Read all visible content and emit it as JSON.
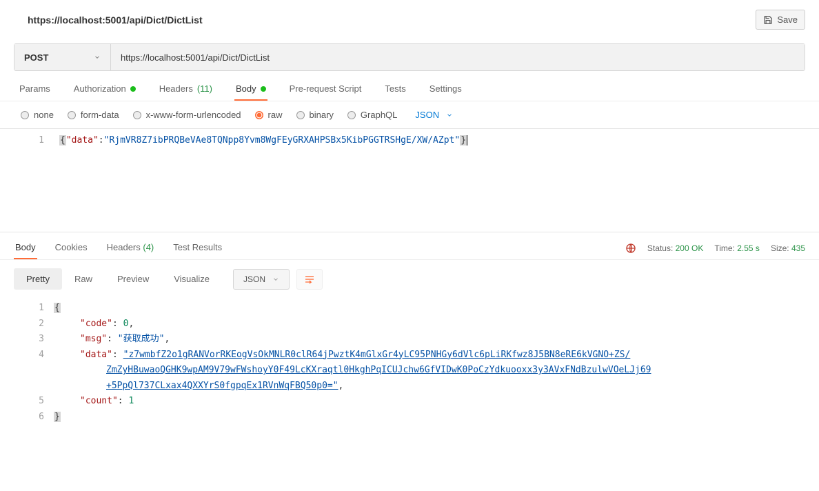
{
  "header": {
    "url_title": "https://localhost:5001/api/Dict/DictList",
    "save_label": "Save"
  },
  "request": {
    "method": "POST",
    "url": "https://localhost:5001/api/Dict/DictList",
    "tabs": {
      "params": "Params",
      "authorization": "Authorization",
      "headers_label": "Headers",
      "headers_count": "(11)",
      "body": "Body",
      "prerequest": "Pre-request Script",
      "tests": "Tests",
      "settings": "Settings"
    },
    "body_types": {
      "none": "none",
      "formdata": "form-data",
      "xwww": "x-www-form-urlencoded",
      "raw": "raw",
      "binary": "binary",
      "graphql": "GraphQL",
      "lang": "JSON"
    },
    "editor": {
      "line1_num": "1",
      "key": "\"data\"",
      "value": "\"RjmVR8Z7ibPRQBeVAe8TQNpp8Yvm8WgFEyGRXAHPSBx5KibPGGTRSHgE/XW/AZpt\""
    }
  },
  "response": {
    "tabs": {
      "body": "Body",
      "cookies": "Cookies",
      "headers_label": "Headers",
      "headers_count": "(4)",
      "testresults": "Test Results"
    },
    "meta": {
      "status_label": "Status:",
      "status_value": "200 OK",
      "time_label": "Time:",
      "time_value": "2.55 s",
      "size_label": "Size:",
      "size_value": "435"
    },
    "view": {
      "pretty": "Pretty",
      "raw": "Raw",
      "preview": "Preview",
      "visualize": "Visualize",
      "format": "JSON"
    },
    "body_lines": {
      "l1": "1",
      "l2": "2",
      "l3": "3",
      "l4": "4",
      "l5": "5",
      "l6": "6",
      "code_key": "\"code\"",
      "code_val": "0",
      "msg_key": "\"msg\"",
      "msg_val": "\"获取成功\"",
      "data_key": "\"data\"",
      "data_val_a": "\"z7wmbfZ2o1gRANVorRKEogVsOkMNLR0clR64jPwztK4mGlxGr4yLC95PNHGy6dVlc6pLiRKfwz8J5BN8eRE6kVGNO+ZS/",
      "data_val_b": "ZmZyHBuwaoQGHK9wpAM9V79wFWshoyY0F49LcKXraqtl0HkghPqICUJchw6GfVIDwK0PoCzYdkuooxx3y3AVxFNdBzulwVOeLJj69",
      "data_val_c": "+5PpQl737CLxax4QXXYrS0fgpqEx1RVnWqFBQ50p0=\"",
      "count_key": "\"count\"",
      "count_val": "1"
    }
  }
}
